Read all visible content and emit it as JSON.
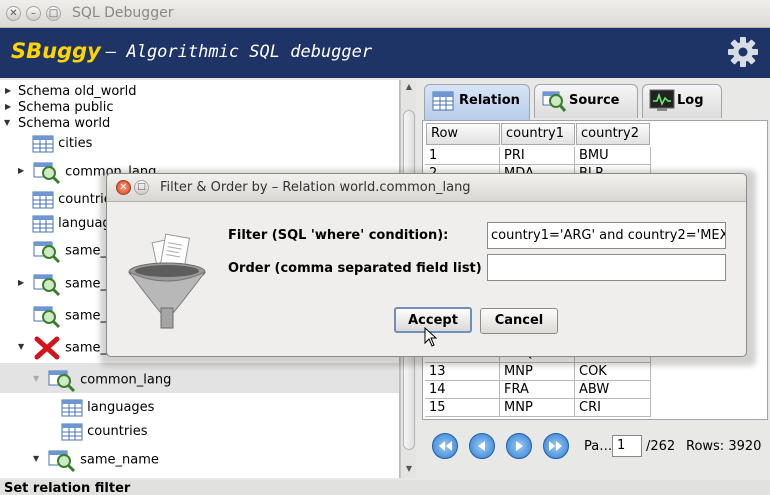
{
  "window": {
    "title": "SQL Debugger"
  },
  "header": {
    "brand": "SBuggy",
    "subtitle": "– Algorithmic SQL debugger",
    "settings_icon": "gear-icon"
  },
  "tree": {
    "schemas": [
      "Schema old_world",
      "Schema public",
      "Schema world"
    ],
    "nodes": [
      "cities",
      "common_lang",
      "countries",
      "languages",
      "same_",
      "same_",
      "same_",
      "same_",
      "common_lang",
      "languages",
      "countries",
      "same_name"
    ]
  },
  "tabs": [
    "Relation",
    "Source",
    "Log"
  ],
  "table": {
    "columns": [
      "Row",
      "country1",
      "country2"
    ],
    "rows": [
      [
        "1",
        "PRI",
        "BMU"
      ],
      [
        "2",
        "MDA",
        "BLR"
      ],
      [
        "12",
        "MTQ",
        "FRA"
      ],
      [
        "13",
        "MNP",
        "COK"
      ],
      [
        "14",
        "FRA",
        "ABW"
      ],
      [
        "15",
        "MNP",
        "CRI"
      ]
    ]
  },
  "pager": {
    "page_label": "Pa…",
    "page_value": "1",
    "total": "/262",
    "rows_label": "Rows: 3920"
  },
  "status": {
    "text": "Set relation filter"
  },
  "dialog": {
    "title": "Filter & Order by – Relation world.common_lang",
    "filter_label": "Filter (SQL 'where' condition):",
    "filter_value": "country1='ARG' and country2='MEX'",
    "order_label": "Order (comma separated field list) :",
    "order_value": "",
    "accept_label": "Accept",
    "cancel_label": "Cancel"
  },
  "colors": {
    "header_bg": "#1f3466",
    "brand": "#ffd500",
    "tab_active": "#c6d8f0"
  }
}
